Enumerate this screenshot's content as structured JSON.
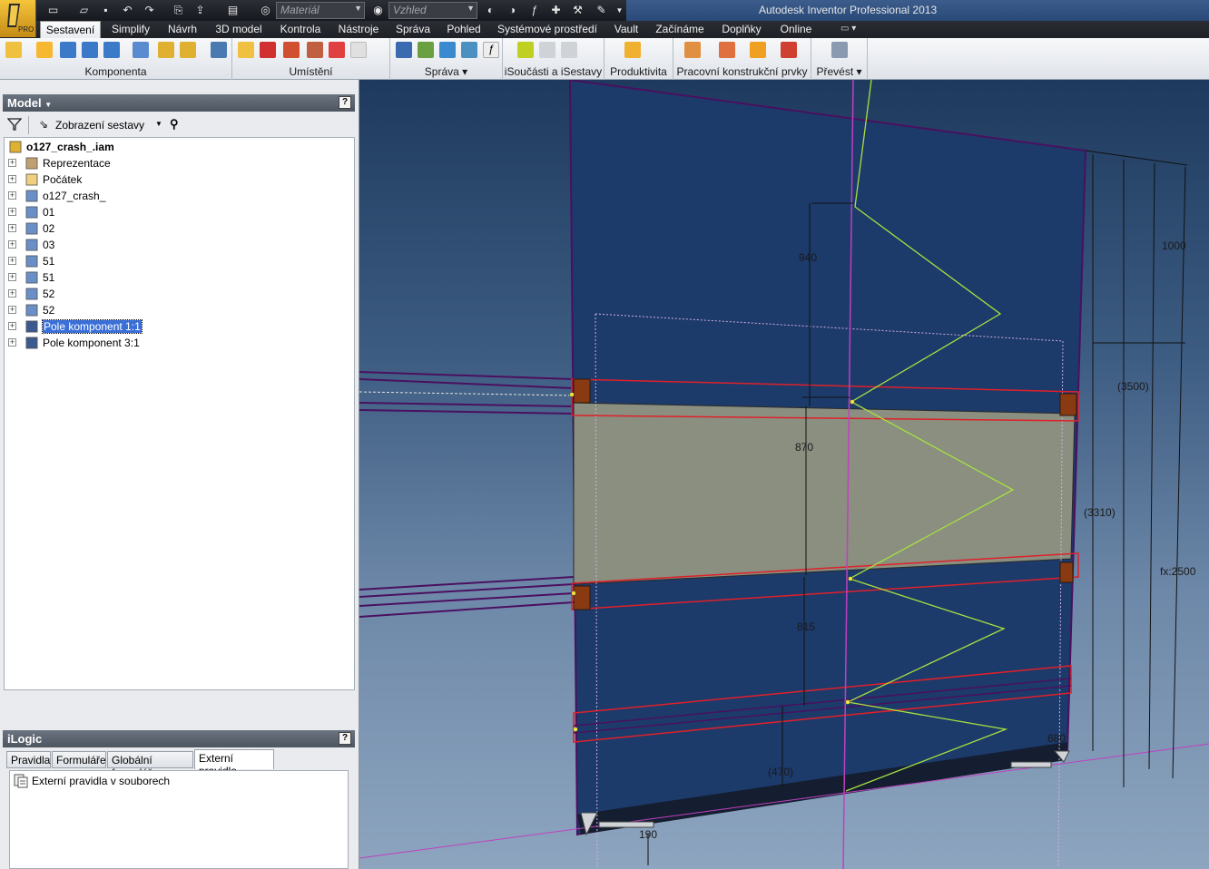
{
  "app": {
    "title": "Autodesk Inventor Professional 2013",
    "badge": "PRO"
  },
  "quick_access": {
    "material": {
      "placeholder": "Materiál"
    },
    "appearance": {
      "placeholder": "Vzhled"
    }
  },
  "tabs": [
    {
      "label": "Sestavení",
      "active": true
    },
    {
      "label": "Simplify"
    },
    {
      "label": "Návrh"
    },
    {
      "label": "3D model"
    },
    {
      "label": "Kontrola"
    },
    {
      "label": "Nástroje"
    },
    {
      "label": "Správa"
    },
    {
      "label": "Pohled"
    },
    {
      "label": "Systémové prostředí"
    },
    {
      "label": "Vault"
    },
    {
      "label": "Začínáme"
    },
    {
      "label": "Doplňky"
    },
    {
      "label": "Online"
    }
  ],
  "ribbon_groups": [
    {
      "label": "Komponenta"
    },
    {
      "label": "Umístění"
    },
    {
      "label": "Správa ▾"
    },
    {
      "label": "iSoučásti a iSestavy"
    },
    {
      "label": "Produktivita"
    },
    {
      "label": "Pracovní konstrukční prvky"
    },
    {
      "label": "Převést ▾"
    }
  ],
  "model_panel": {
    "title": "Model",
    "help": "?",
    "view_label": "Zobrazení sestavy",
    "tree": [
      {
        "label": "o127_crash_.iam",
        "icon": "assembly-icon",
        "root": true
      },
      {
        "label": "Reprezentace",
        "icon": "representations-icon"
      },
      {
        "label": "Počátek",
        "icon": "folder-icon"
      },
      {
        "label": "o127_crash_",
        "icon": "part-icon"
      },
      {
        "label": "01",
        "icon": "part-icon"
      },
      {
        "label": "02",
        "icon": "part-icon"
      },
      {
        "label": "03",
        "icon": "part-icon"
      },
      {
        "label": "51",
        "icon": "part-icon"
      },
      {
        "label": "51",
        "icon": "part-icon"
      },
      {
        "label": "52",
        "icon": "part-icon"
      },
      {
        "label": "52",
        "icon": "part-icon"
      },
      {
        "label": "Pole komponent 1:1",
        "icon": "pattern-icon",
        "selected": true
      },
      {
        "label": "Pole komponent 3:1",
        "icon": "pattern-icon"
      }
    ]
  },
  "ilogic_panel": {
    "title": "iLogic",
    "help": "?",
    "tabs": [
      {
        "label": "Pravidla"
      },
      {
        "label": "Formuláře"
      },
      {
        "label": "Globální formuláře"
      },
      {
        "label": "Externí pravidla",
        "active": true
      }
    ],
    "items": [
      {
        "label": "Externí pravidla v souborech",
        "icon": "rules-icon"
      }
    ]
  },
  "viewport": {
    "dimensions": [
      {
        "label": "940"
      },
      {
        "label": "870"
      },
      {
        "label": "815"
      },
      {
        "label": "(470)"
      },
      {
        "label": "190"
      },
      {
        "label": "680"
      },
      {
        "label": "1000"
      },
      {
        "label": "(3500)"
      },
      {
        "label": "(3310)"
      },
      {
        "label": "fx:2500"
      }
    ],
    "colors": {
      "panel": "#1c3a6a",
      "glass": "#8a8f80",
      "sketch_red": "#e0202a",
      "sketch_yellow": "#e8f040",
      "sketch_green": "#7ad040",
      "axis_magenta": "#c040c0",
      "edge_purple": "#4a1060",
      "bracket": "#8a3a10"
    }
  }
}
